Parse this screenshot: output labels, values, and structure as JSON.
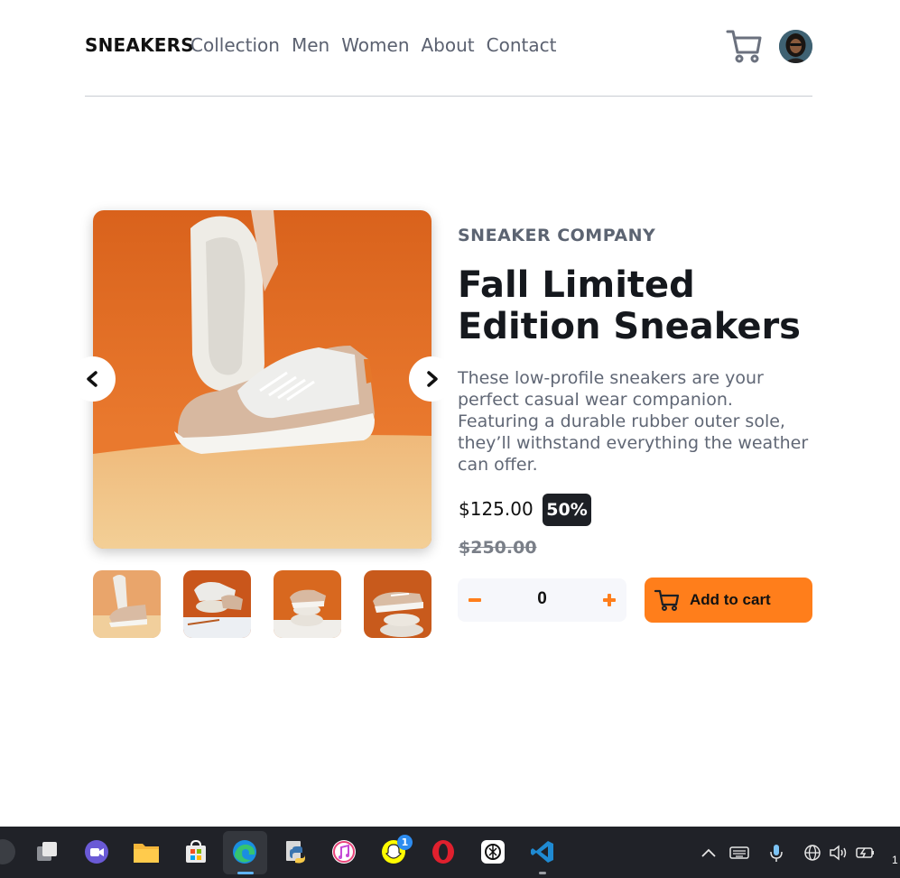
{
  "header": {
    "brand": "SNEAKERS",
    "nav": [
      "Collection",
      "Men",
      "Women",
      "About",
      "Contact"
    ],
    "cart_icon": "cart-icon",
    "avatar_icon": "avatar"
  },
  "gallery": {
    "prev_icon": "chevron-left-icon",
    "next_icon": "chevron-right-icon",
    "thumbnail_count": 4
  },
  "product": {
    "company": "SNEAKER COMPANY",
    "title": "Fall Limited Edition Sneakers",
    "description": "These low-profile sneakers are your perfect casual wear companion. Featuring a durable rubber outer sole, they’ll withstand everything the weather can offer.",
    "price": "$125.00",
    "discount": "50%",
    "original_price": "$250.00"
  },
  "cart_controls": {
    "minus": "−",
    "quantity": "0",
    "plus": "+",
    "add_label": "Add to cart"
  },
  "taskbar": {
    "notification_count": "1",
    "clock_partial": "1"
  },
  "colors": {
    "accent": "#ff7e1b",
    "dark": "#1d2025",
    "taskbar": "#202228"
  }
}
